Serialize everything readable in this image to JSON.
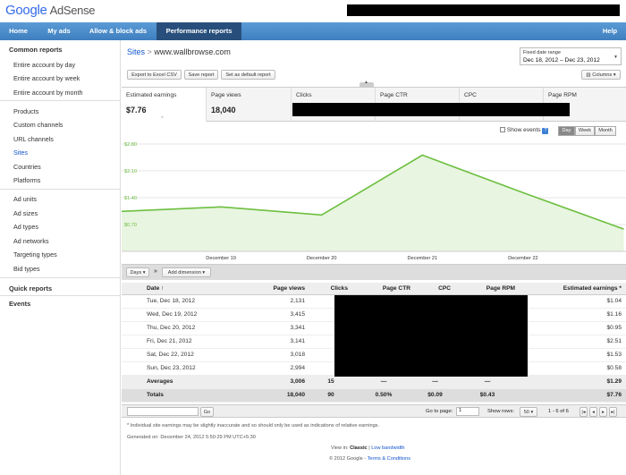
{
  "brand": {
    "google": "Google",
    "product": "AdSense"
  },
  "nav": [
    "Home",
    "My ads",
    "Allow & block ads",
    "Performance reports",
    "Help"
  ],
  "sidebar": {
    "common_header": "Common reports",
    "common": [
      "Entire account by day",
      "Entire account by week",
      "Entire account by month"
    ],
    "group1": [
      "Products",
      "Custom channels",
      "URL channels",
      "Sites",
      "Countries",
      "Platforms"
    ],
    "group2": [
      "Ad units",
      "Ad sizes",
      "Ad types",
      "Ad networks",
      "Targeting types",
      "Bid types"
    ],
    "quick": "Quick reports",
    "events": "Events"
  },
  "breadcrumb": {
    "root": "Sites",
    "sep": ">",
    "current": "www.wallbrowse.com"
  },
  "actions": {
    "export": "Export to Excel CSV",
    "save": "Save report",
    "default": "Set as default report"
  },
  "date_range": {
    "label": "Fixed date range",
    "value": "Dec 18, 2012 – Dec 23, 2012"
  },
  "columns_label": "Columns",
  "metrics": [
    {
      "label": "Estimated earnings",
      "value": "$7.76"
    },
    {
      "label": "Page views",
      "value": "18,040"
    },
    {
      "label": "Clicks",
      "value": ""
    },
    {
      "label": "Page CTR",
      "value": ""
    },
    {
      "label": "CPC",
      "value": ""
    },
    {
      "label": "Page RPM",
      "value": ""
    }
  ],
  "chart_controls": {
    "show_events": "Show events",
    "day": "Day",
    "week": "Week",
    "month": "Month"
  },
  "chart_data": {
    "type": "area",
    "x": [
      "December 18",
      "December 19",
      "December 20",
      "December 21",
      "December 22",
      "December 23"
    ],
    "xticks": [
      "December 19",
      "December 20",
      "December 21",
      "December 22"
    ],
    "values": [
      1.04,
      1.16,
      0.95,
      2.51,
      1.53,
      0.58
    ],
    "yticks": [
      "$2.80",
      "$2.10",
      "$1.40",
      "$0.70"
    ],
    "ytick_values": [
      2.8,
      2.1,
      1.4,
      0.7
    ],
    "ylim": [
      0,
      2.8
    ],
    "color": "#6cbf3f",
    "grid": true
  },
  "table_toolbar": {
    "days": "Days",
    "add_dimension": "Add dimension"
  },
  "table": {
    "headers": [
      "Date",
      "Page views",
      "Clicks",
      "Page CTR",
      "CPC",
      "Page RPM",
      "Estimated earnings"
    ],
    "rows": [
      [
        "Tue, Dec 18, 2012",
        "2,131",
        "$1.04"
      ],
      [
        "Wed, Dec 19, 2012",
        "3,415",
        "$1.16"
      ],
      [
        "Thu, Dec 20, 2012",
        "3,341",
        "$0.95"
      ],
      [
        "Fri, Dec 21, 2012",
        "3,141",
        "$2.51"
      ],
      [
        "Sat, Dec 22, 2012",
        "3,018",
        "$1.53"
      ],
      [
        "Sun, Dec 23, 2012",
        "2,994",
        "$0.58"
      ]
    ],
    "averages": [
      "Averages",
      "3,006",
      "15",
      "—",
      "—",
      "—",
      "$1.29"
    ],
    "totals": [
      "Totals",
      "18,040",
      "90",
      "0.50%",
      "$0.09",
      "$0.43",
      "$7.76"
    ]
  },
  "pager": {
    "go": "Go",
    "goto": "Go to page:",
    "page": "1",
    "show_rows": "Show rows:",
    "rows": "50",
    "range": "1 - 6 of 6"
  },
  "footer": {
    "note": "* Individual site earnings may be slightly inaccurate and so should only be used as indications of relative earnings.",
    "generated": "Generated on: December 24, 2012 5:50:29 PM UTC+5:30",
    "view_in": "View in:",
    "classic": "Classic",
    "low_bw": "Low bandwidth",
    "copyright": "© 2012 Google -",
    "terms": "Terms & Conditions"
  }
}
